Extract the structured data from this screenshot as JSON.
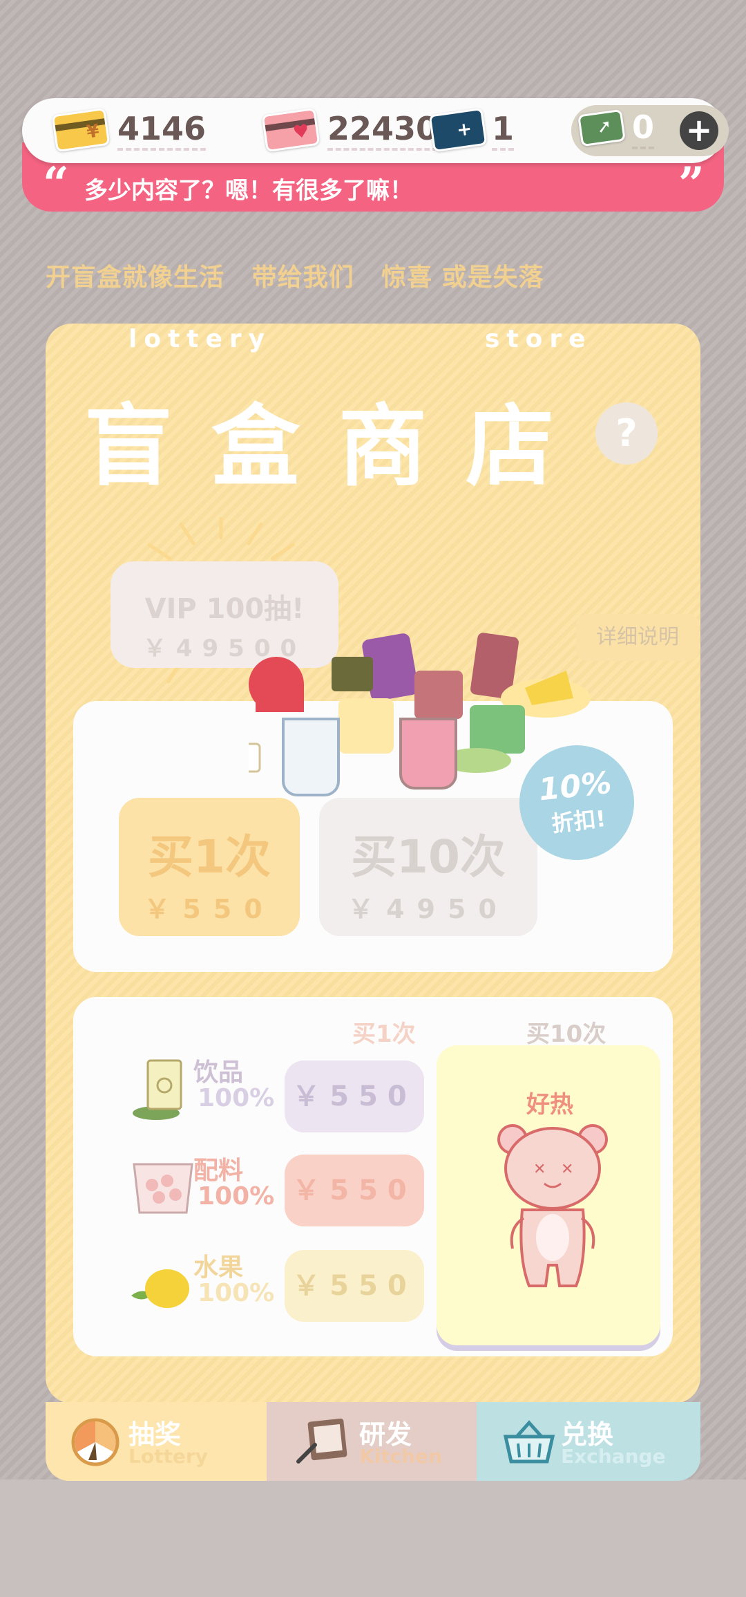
{
  "currency": {
    "coins": "4146",
    "hearts": "22430",
    "tickets": "1",
    "wallet": "0",
    "add_label": "+"
  },
  "marquee": {
    "open_quote": "“",
    "close_quote": "”",
    "text": "多少内容了？嗯！有很多了嘛！"
  },
  "slogan": [
    "开盲盒就像生活",
    "带给我们",
    "惊喜 或是失落"
  ],
  "store": {
    "en_left": "lottery",
    "en_right": "store",
    "title": "盲盒商店",
    "help_label": "?"
  },
  "vip": {
    "title": "VIP 100抽!",
    "price": "￥49500"
  },
  "detail_label": "详细说明",
  "buy_once": {
    "label": "买1次",
    "price": "￥550"
  },
  "buy_ten": {
    "label": "买10次",
    "price": "￥4950"
  },
  "discount": {
    "pct": "10%",
    "text": "折扣!"
  },
  "columns": {
    "once": "买1次",
    "ten": "买10次"
  },
  "categories": [
    {
      "name": "饮品",
      "pct": "100%",
      "price": "￥550"
    },
    {
      "name": "配料",
      "pct": "100%",
      "price": "￥550"
    },
    {
      "name": "水果",
      "pct": "100%",
      "price": "￥550"
    }
  ],
  "hot": {
    "label": "好热"
  },
  "nav": [
    {
      "cn": "抽奖",
      "en": "Lottery"
    },
    {
      "cn": "研发",
      "en": "Kitchen"
    },
    {
      "cn": "兑换",
      "en": "Exchange"
    }
  ],
  "colors": {
    "panel": "#fde3a3",
    "marquee": "#f46482",
    "accent_orange": "#f4c77e",
    "discount_blue": "#a9d5e4"
  }
}
